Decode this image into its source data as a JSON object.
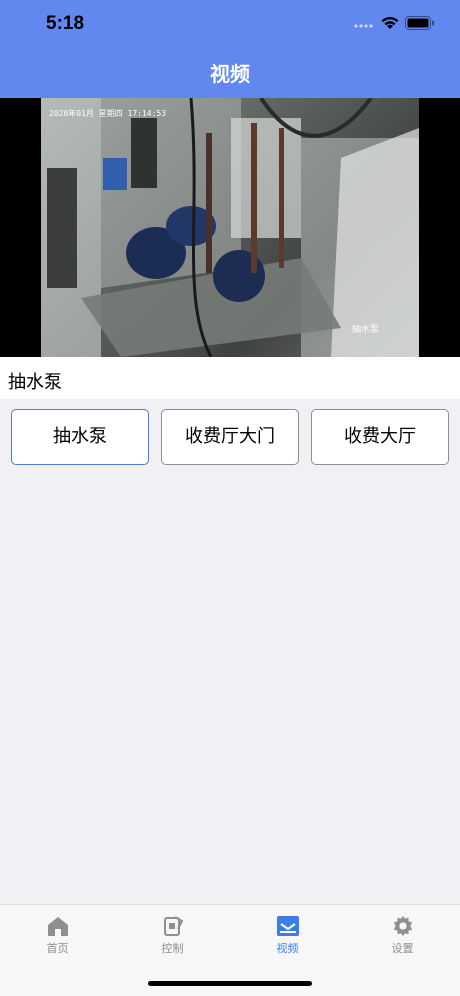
{
  "status_bar": {
    "time": "5:18"
  },
  "header": {
    "title": "视频"
  },
  "video": {
    "overlay_text": "2020年01月  星期四 17:14:53",
    "camera_label": "抽水泵"
  },
  "current_camera": "抽水泵",
  "cameras": [
    {
      "label": "抽水泵",
      "selected": true
    },
    {
      "label": "收费厅大门",
      "selected": false
    },
    {
      "label": "收费大厅",
      "selected": false
    }
  ],
  "tabs": [
    {
      "label": "首页",
      "icon": "home-icon",
      "active": false
    },
    {
      "label": "控制",
      "icon": "control-icon",
      "active": false
    },
    {
      "label": "视频",
      "icon": "video-icon",
      "active": true
    },
    {
      "label": "设置",
      "icon": "gear-icon",
      "active": false
    }
  ],
  "colors": {
    "header": "#6288ef",
    "accent": "#3b7ee8",
    "background": "#f1f1f5"
  }
}
